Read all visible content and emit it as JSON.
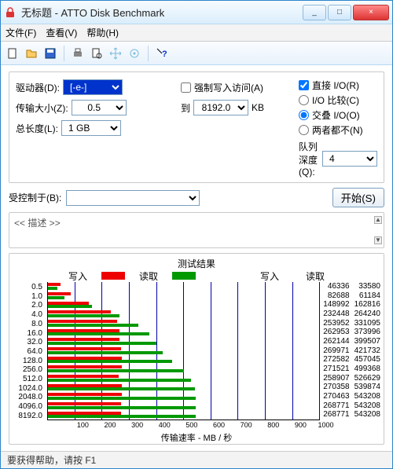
{
  "window": {
    "title": "无标题 - ATTO Disk Benchmark",
    "min_tip": "_",
    "max_tip": "□",
    "close_tip": "×"
  },
  "menu": {
    "file": "文件(F)",
    "view": "查看(V)",
    "help": "帮助(H)"
  },
  "params": {
    "drive_label": "驱动器(D):",
    "drive_value": "[-e-]",
    "xfer_label": "传输大小(Z):",
    "xfer_from": "0.5",
    "xfer_to_label": "到",
    "xfer_to": "8192.0",
    "xfer_unit": "KB",
    "len_label": "总长度(L):",
    "len_value": "1 GB",
    "force_write": "强制写入访问(A)",
    "direct_io": "直接 I/O(R)",
    "io_compare": "I/O 比较(C)",
    "overlap_io": "交叠 I/O(O)",
    "neither": "两者都不(N)",
    "queue_label": "队列深度(Q):",
    "queue_value": "4"
  },
  "controlled": {
    "label": "受控制于(B):",
    "value": ""
  },
  "start_label": "开始(S)",
  "desc_placeholder": "<< 描述 >>",
  "chart_title": "测试结果",
  "legend": {
    "write": "写入",
    "read": "读取"
  },
  "xlabel": "传输速率 - MB / 秒",
  "vals_header": {
    "write": "写入",
    "read": "读取"
  },
  "status": "要获得帮助，请按 F1",
  "chart_data": {
    "type": "bar",
    "orientation": "horizontal",
    "categories": [
      "0.5",
      "1.0",
      "2.0",
      "4.0",
      "8.0",
      "16.0",
      "32.0",
      "64.0",
      "128.0",
      "256.0",
      "512.0",
      "1024.0",
      "2048.0",
      "4096.0",
      "8192.0"
    ],
    "series": [
      {
        "name": "写入",
        "color": "#e00000",
        "values": [
          46336,
          82688,
          148992,
          232448,
          253952,
          262953,
          262144,
          269971,
          272582,
          271521,
          258907,
          270358,
          270463,
          268771,
          268771
        ]
      },
      {
        "name": "读取",
        "color": "#009000",
        "values": [
          33580,
          61184,
          162816,
          264240,
          331095,
          373996,
          399507,
          421732,
          457045,
          499368,
          526629,
          539874,
          543208,
          543208,
          543208
        ]
      }
    ],
    "xlim": [
      0,
      1000
    ],
    "xticks": [
      0,
      100,
      200,
      300,
      400,
      500,
      600,
      700,
      800,
      900,
      1000
    ],
    "xlabel": "传输速率 - MB / 秒",
    "ylabel": "",
    "unit": "KB/s"
  }
}
